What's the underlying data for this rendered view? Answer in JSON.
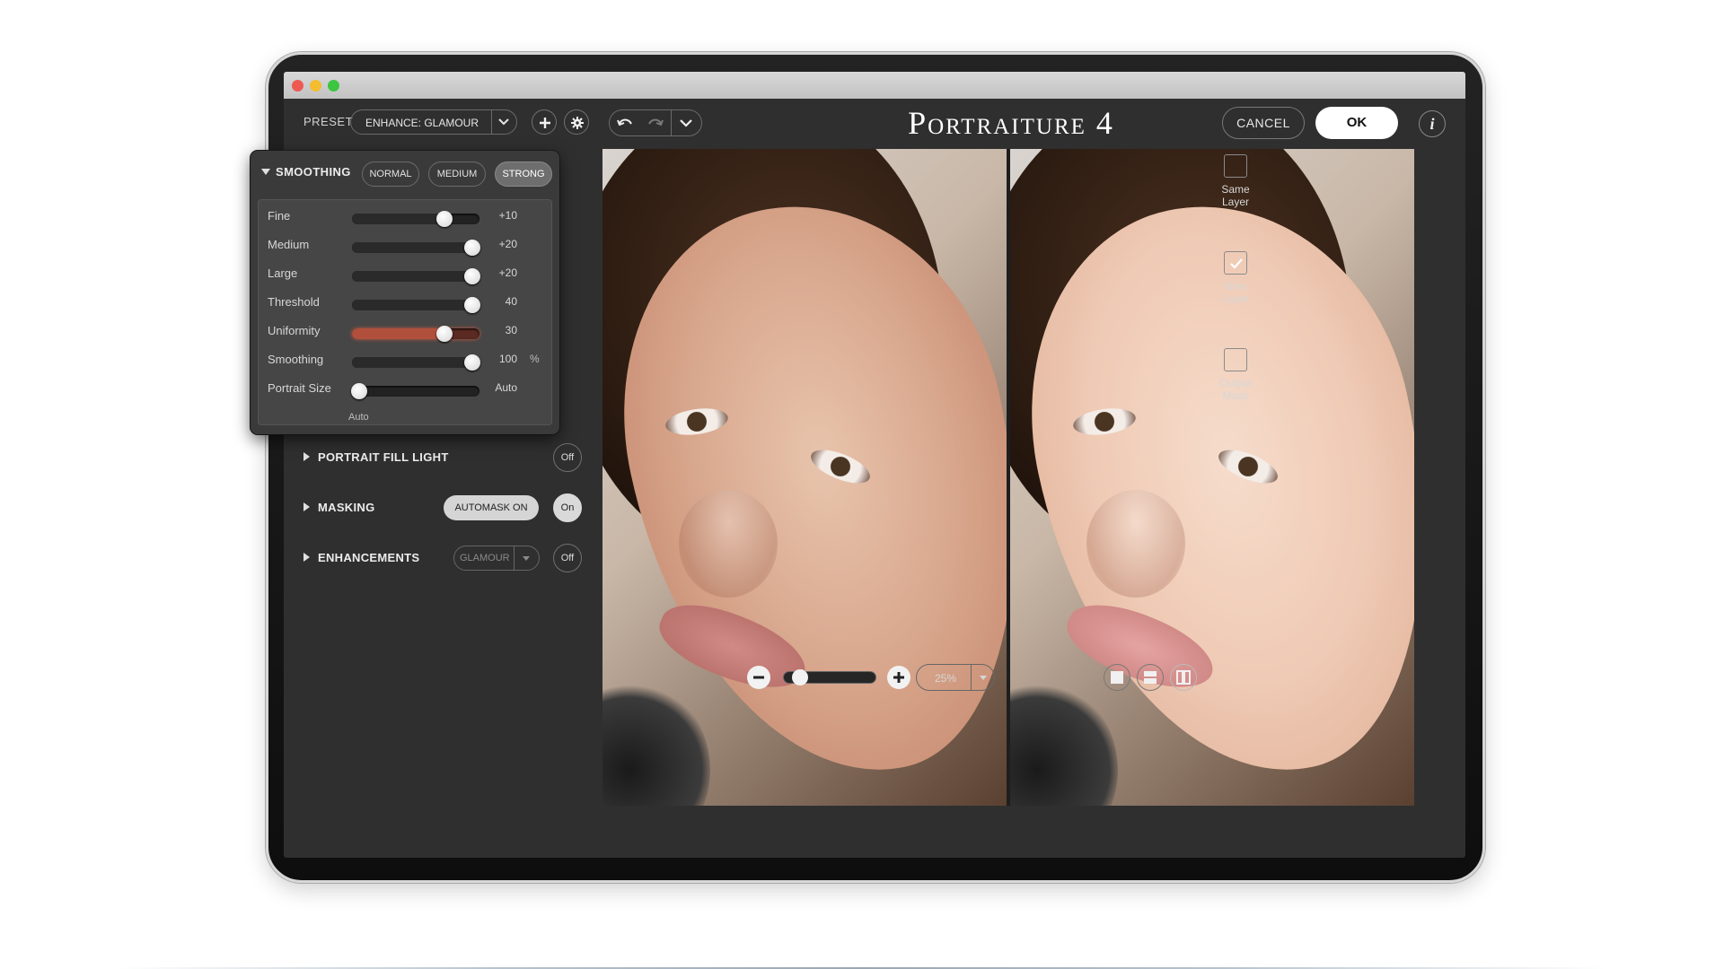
{
  "window": {
    "app_title": "Portraiture 4"
  },
  "toolbar": {
    "preset_label": "PRESET",
    "preset_value": "ENHANCE: GLAMOUR",
    "cancel_label": "CANCEL",
    "ok_label": "OK",
    "info_label": "i"
  },
  "smoothing": {
    "title": "SMOOTHING",
    "modes": [
      {
        "label": "NORMAL",
        "active": false
      },
      {
        "label": "MEDIUM",
        "active": false
      },
      {
        "label": "STRONG",
        "active": true
      }
    ],
    "sliders": [
      {
        "label": "Fine",
        "value": "+10",
        "level": 0.75
      },
      {
        "label": "Medium",
        "value": "+20",
        "level": 1.0
      },
      {
        "label": "Large",
        "value": "+20",
        "level": 1.0
      },
      {
        "label": "Threshold",
        "value": "40",
        "level": 1.0
      },
      {
        "label": "Uniformity",
        "value": "30",
        "level": 0.75,
        "highlighted": true
      },
      {
        "label": "Smoothing",
        "value": "100",
        "unit": "%",
        "level": 1.0
      },
      {
        "label": "Portrait Size",
        "value": "Auto",
        "level": 0.0
      }
    ],
    "portrait_size_sub": "Auto"
  },
  "sections": {
    "fill_light": {
      "title": "PORTRAIT FILL LIGHT",
      "toggle": "Off"
    },
    "masking": {
      "title": "MASKING",
      "automask": "AUTOMASK ON",
      "toggle": "On"
    },
    "enhancements": {
      "title": "ENHANCEMENTS",
      "preset": "GLAMOUR",
      "toggle": "Off"
    }
  },
  "output_options": [
    {
      "label_line1": "Same",
      "label_line2": "Layer",
      "checked": false
    },
    {
      "label_line1": "New",
      "label_line2": "Layer",
      "checked": true
    },
    {
      "label_line1": "Output",
      "label_line2": "Mask",
      "checked": false
    }
  ],
  "zoom": {
    "value": "25%",
    "level": 0.1
  },
  "colors": {
    "panel_bg": "#2f2f2f",
    "highlight": "#b0503c",
    "ok_bg": "#ffffff"
  }
}
